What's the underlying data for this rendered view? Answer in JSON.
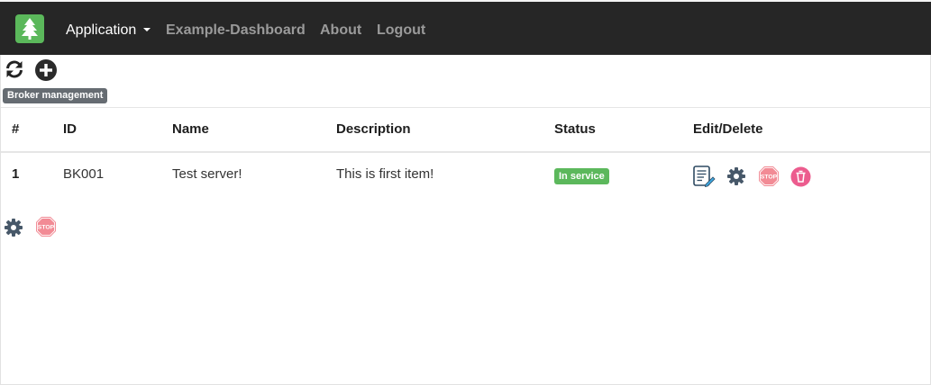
{
  "navbar": {
    "app_label": "Application",
    "links": [
      "Example-Dashboard",
      "About",
      "Logout"
    ]
  },
  "toolbar": {
    "refresh_icon": "refresh-icon",
    "add_icon": "plus-circle-icon",
    "tooltip": "Broker management"
  },
  "table": {
    "headers": [
      "#",
      "ID",
      "Name",
      "Description",
      "Status",
      "Edit/Delete"
    ],
    "rows": [
      {
        "num": "1",
        "id": "BK001",
        "name": "Test server!",
        "description": "This is first item!",
        "status": "In service",
        "actions": [
          "edit-document-icon",
          "gear-icon",
          "stop-sign-icon",
          "trash-icon"
        ]
      }
    ]
  },
  "stop_label": "STOP",
  "colors": {
    "navbar": "#262626",
    "brand": "#5bb85b",
    "status_ok": "#5cb85c",
    "stop": "#f28b95",
    "trash": "#ec5c8e",
    "gear": "#475869"
  }
}
